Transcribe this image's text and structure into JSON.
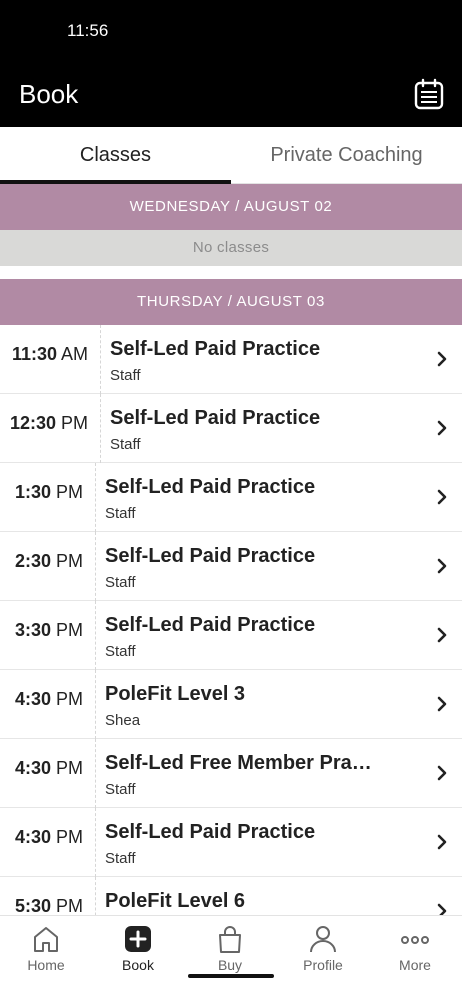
{
  "status_bar": {
    "time": "11:56"
  },
  "header": {
    "title": "Book",
    "calendar_icon": "calendar-icon"
  },
  "tabs": [
    {
      "label": "Classes",
      "active": true
    },
    {
      "label": "Private Coaching",
      "active": false
    }
  ],
  "schedule": {
    "day1": {
      "label": "WEDNESDAY / AUGUST 02",
      "empty_text": "No classes"
    },
    "day2": {
      "label": "THURSDAY / AUGUST 03",
      "classes": [
        {
          "hm": "11:30",
          "ampm": "AM",
          "name": "Self-Led Paid Practice",
          "instructor": "Staff"
        },
        {
          "hm": "12:30",
          "ampm": "PM",
          "name": "Self-Led Paid Practice",
          "instructor": "Staff"
        },
        {
          "hm": "1:30",
          "ampm": "PM",
          "name": "Self-Led Paid Practice",
          "instructor": "Staff"
        },
        {
          "hm": "2:30",
          "ampm": "PM",
          "name": "Self-Led Paid Practice",
          "instructor": "Staff"
        },
        {
          "hm": "3:30",
          "ampm": "PM",
          "name": "Self-Led Paid Practice",
          "instructor": "Staff"
        },
        {
          "hm": "4:30",
          "ampm": "PM",
          "name": "PoleFit Level 3",
          "instructor": "Shea"
        },
        {
          "hm": "4:30",
          "ampm": "PM",
          "name": "Self-Led Free Member Pra…",
          "instructor": "Staff"
        },
        {
          "hm": "4:30",
          "ampm": "PM",
          "name": "Self-Led Paid Practice",
          "instructor": "Staff"
        },
        {
          "hm": "5:30",
          "ampm": "PM",
          "name": "PoleFit Level 6",
          "instructor": ""
        }
      ]
    }
  },
  "bottom_nav": [
    {
      "label": "Home",
      "icon": "home-icon",
      "active": false
    },
    {
      "label": "Book",
      "icon": "plus-icon",
      "active": true
    },
    {
      "label": "Buy",
      "icon": "bag-icon",
      "active": false
    },
    {
      "label": "Profile",
      "icon": "person-icon",
      "active": false
    },
    {
      "label": "More",
      "icon": "more-icon",
      "active": false
    }
  ],
  "colors": {
    "header_bg": "#000000",
    "date_header_bg": "#b18aa4",
    "no_classes_bg": "#d9d9d7",
    "active_tab_underline": "#111111"
  }
}
